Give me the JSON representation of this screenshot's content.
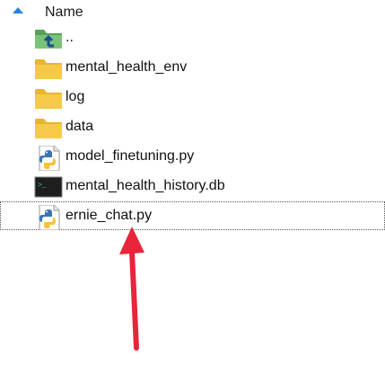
{
  "header": {
    "name_column": "Name"
  },
  "files": [
    {
      "name": "..",
      "icon": "parent-folder-icon"
    },
    {
      "name": "mental_health_env",
      "icon": "folder-icon"
    },
    {
      "name": "log",
      "icon": "folder-icon"
    },
    {
      "name": "data",
      "icon": "folder-icon"
    },
    {
      "name": "model_finetuning.py",
      "icon": "python-file-icon"
    },
    {
      "name": "mental_health_history.db",
      "icon": "terminal-file-icon"
    },
    {
      "name": "ernie_chat.py",
      "icon": "python-file-icon",
      "focused": true
    }
  ],
  "colors": {
    "folder": "#f7c948",
    "sort_arrow": "#2a83d8",
    "annotation_arrow": "#e8253a"
  }
}
